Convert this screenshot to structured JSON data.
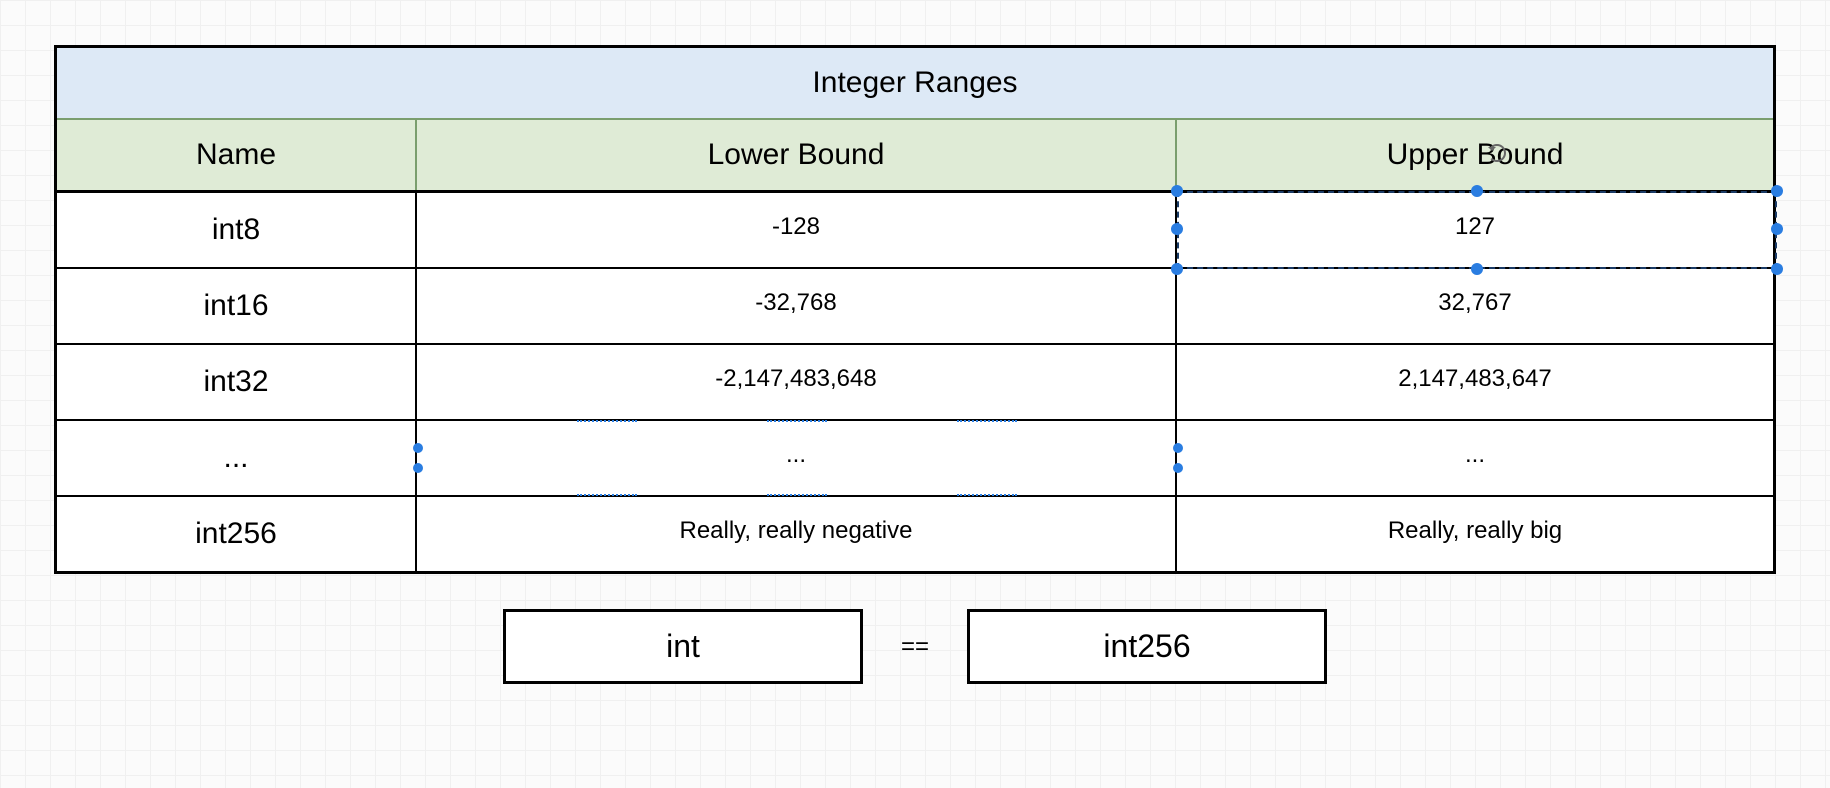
{
  "title": "Integer Ranges",
  "columns": {
    "name": "Name",
    "lower": "Lower Bound",
    "upper": "Upper Bound"
  },
  "rows": [
    {
      "name": "int8",
      "lower": "-128",
      "upper": "127"
    },
    {
      "name": "int16",
      "lower": "-32,768",
      "upper": "32,767"
    },
    {
      "name": "int32",
      "lower": "-2,147,483,648",
      "upper": "2,147,483,647"
    },
    {
      "name": "...",
      "lower": "...",
      "upper": "..."
    },
    {
      "name": "int256",
      "lower": "Really, really negative",
      "upper": "Really, really big"
    }
  ],
  "equation": {
    "left": "int",
    "operator": "==",
    "right": "int256"
  },
  "selection": {
    "row_index": 0,
    "column": "upper"
  },
  "chart_data": {
    "type": "table",
    "title": "Integer Ranges",
    "columns": [
      "Name",
      "Lower Bound",
      "Upper Bound"
    ],
    "rows": [
      [
        "int8",
        "-128",
        "127"
      ],
      [
        "int16",
        "-32,768",
        "32,767"
      ],
      [
        "int32",
        "-2,147,483,648",
        "2,147,483,647"
      ],
      [
        "...",
        "...",
        "..."
      ],
      [
        "int256",
        "Really, really negative",
        "Really, really big"
      ]
    ],
    "footnote": "int == int256"
  }
}
